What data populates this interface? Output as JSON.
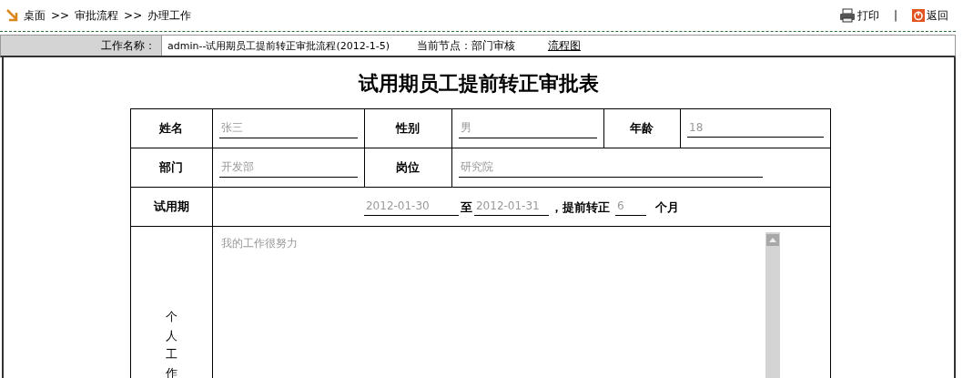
{
  "breadcrumb": [
    "桌面",
    "审批流程",
    "办理工作"
  ],
  "breadcrumb_separator": ">>",
  "actions": [
    {
      "kind": "print",
      "label": "打印"
    },
    {
      "kind": "back",
      "label": "返回"
    }
  ],
  "action_separator": "|",
  "info_bar": {
    "label": "工作名称：",
    "work_name": "admin--试用期员工提前转正审批流程(2012-1-5)",
    "node": "当前节点：部门审核",
    "flow_link": "流程图"
  },
  "form": {
    "title": "试用期员工提前转正审批表",
    "name": {
      "label": "姓名",
      "value": "张三"
    },
    "gender": {
      "label": "性别",
      "value": "男"
    },
    "age": {
      "label": "年龄",
      "value": "18"
    },
    "department": {
      "label": "部门",
      "value": "开发部"
    },
    "position": {
      "label": "岗位",
      "value": "研究院"
    },
    "probation": {
      "label": "试用期",
      "start": "2012-01-30",
      "to": "至",
      "end": "2012-01-31",
      "early_label": "，提前转正",
      "months": "6",
      "unit": "个月"
    },
    "work": {
      "label": "个人工作",
      "value": "我的工作很努力"
    }
  }
}
